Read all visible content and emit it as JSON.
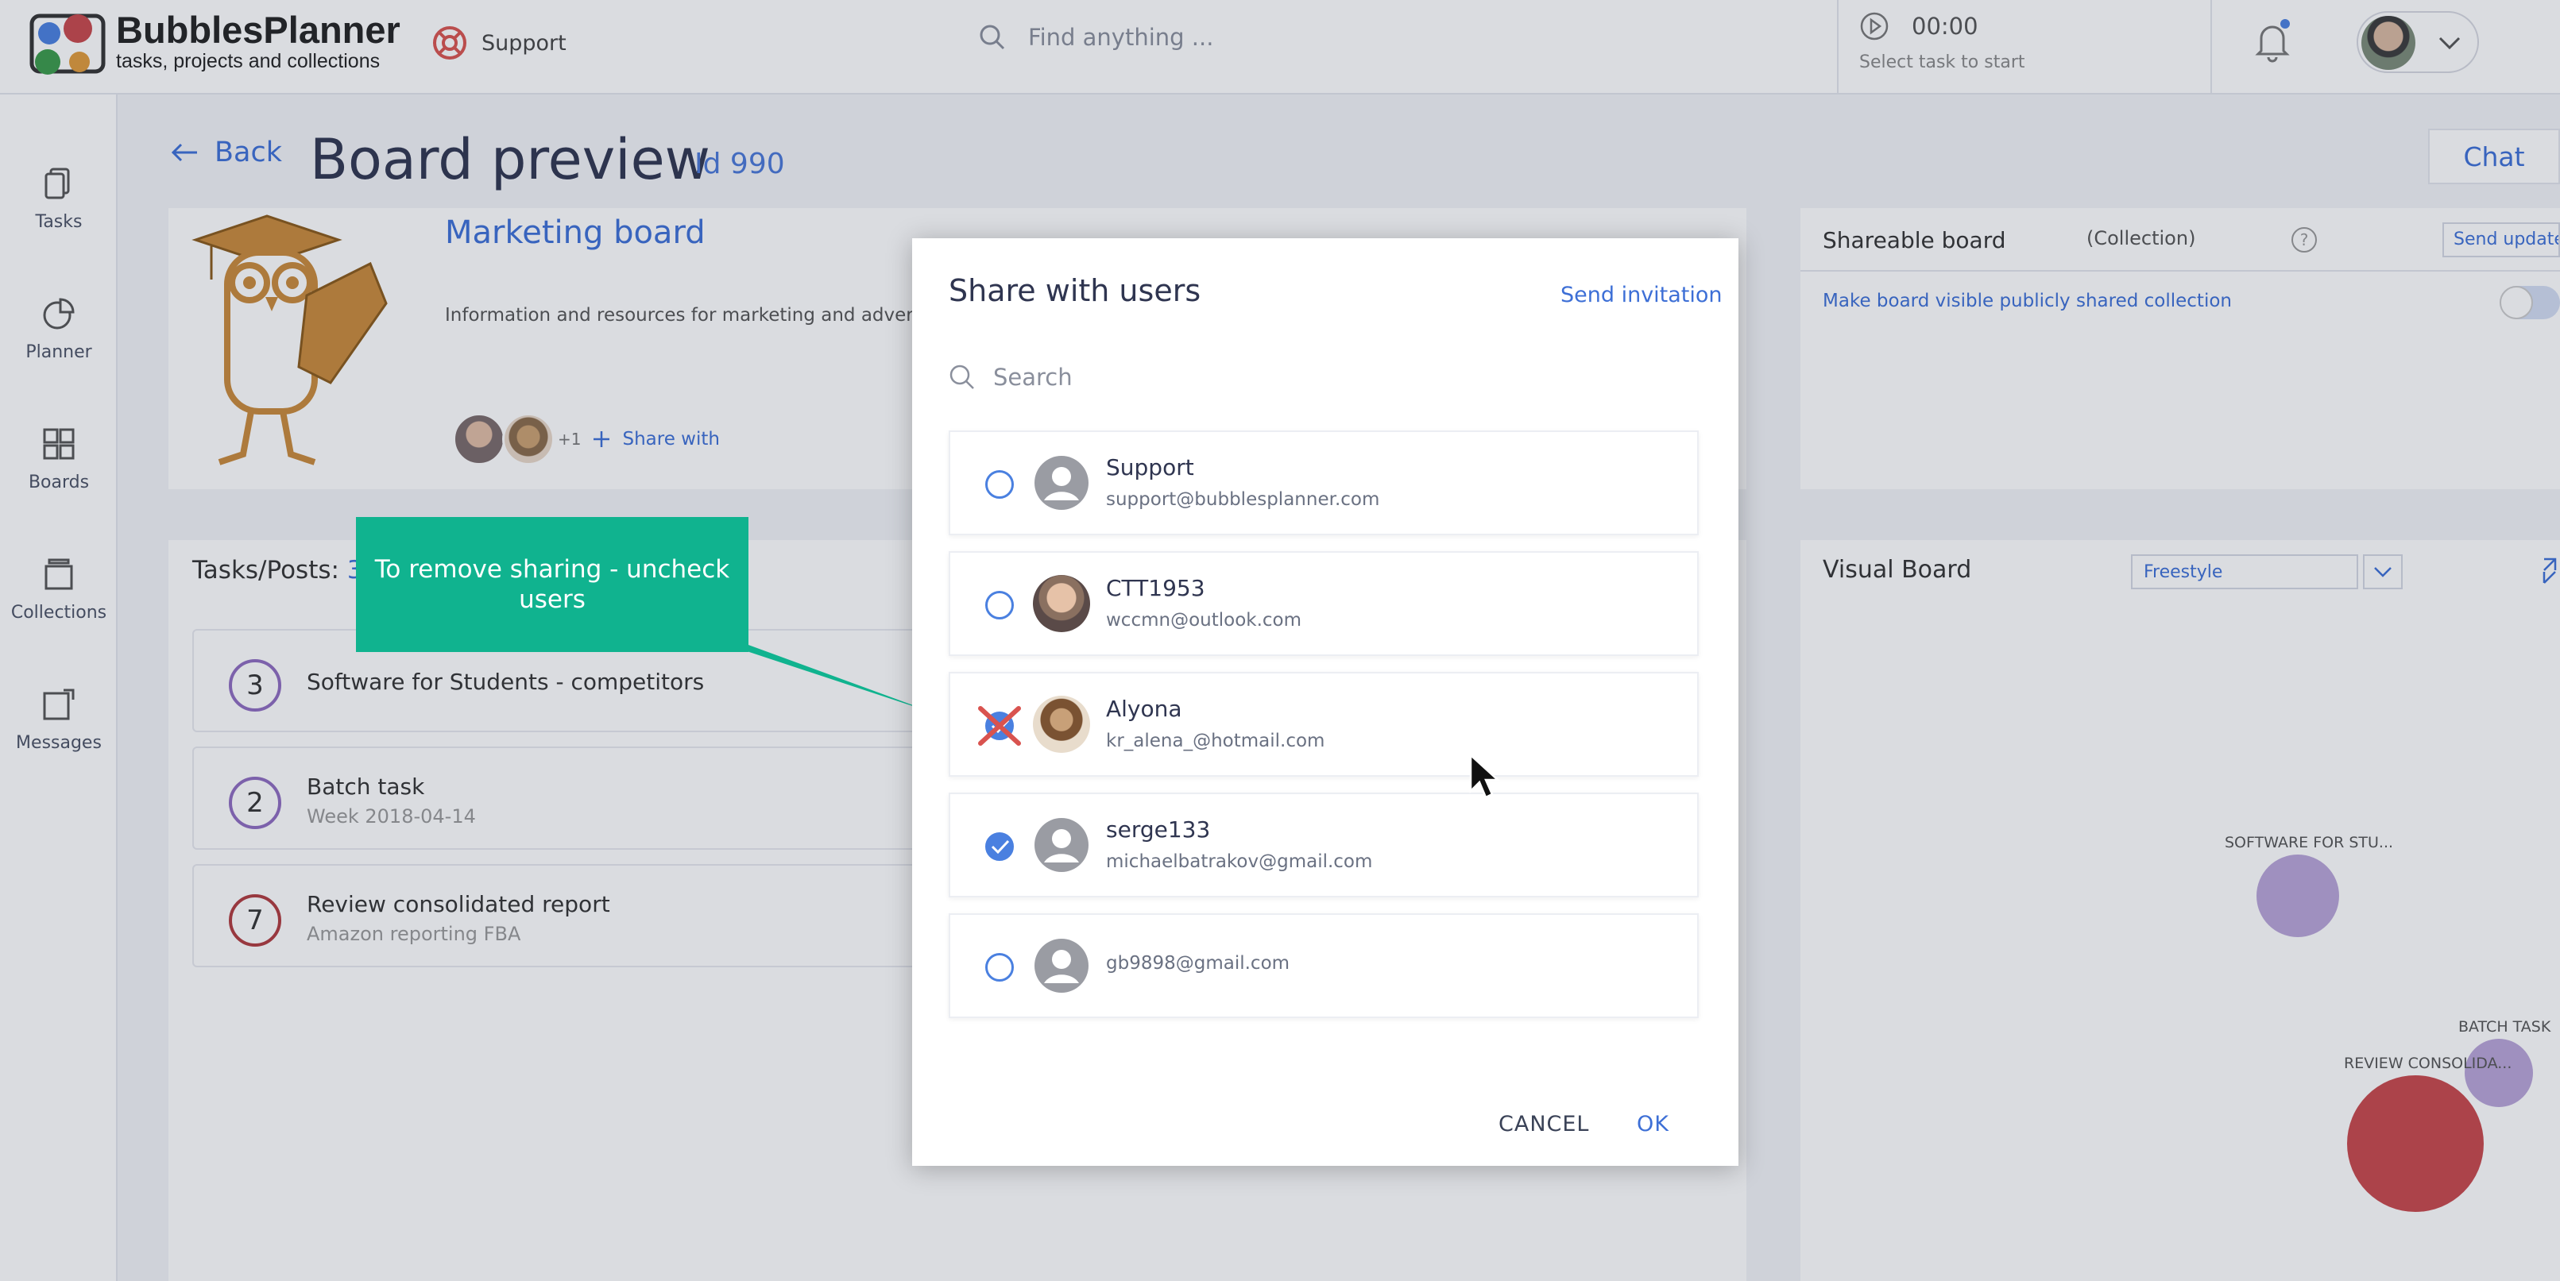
{
  "app": {
    "name": "BubblesPlanner",
    "tagline": "tasks, projects and collections"
  },
  "topbar": {
    "support_label": "Support",
    "search_placeholder": "Find anything ...",
    "timer_time": "00:00",
    "timer_hint": "Select task to start"
  },
  "sidebar": {
    "items": [
      {
        "label": "Tasks",
        "icon": "tasks-icon"
      },
      {
        "label": "Planner",
        "icon": "planner-icon"
      },
      {
        "label": "Boards",
        "icon": "boards-icon"
      },
      {
        "label": "Collections",
        "icon": "collections-icon"
      },
      {
        "label": "Messages",
        "icon": "messages-icon"
      }
    ]
  },
  "page": {
    "back_label": "Back",
    "title": "Board preview",
    "id_label": "Id 990",
    "chat_label": "Chat"
  },
  "board": {
    "name": "Marketing board",
    "description": "Information and resources for marketing and advertising",
    "extra_members": "+1",
    "share_with_label": "Share with"
  },
  "tasks": {
    "title": "Tasks/Posts:",
    "count": "3",
    "items": [
      {
        "number": "3",
        "name": "Software for Students - competitors",
        "sub": ""
      },
      {
        "number": "2",
        "name": "Batch task",
        "sub": "Week 2018-04-14"
      },
      {
        "number": "7",
        "name": "Review consolidated report",
        "sub": "Amazon reporting FBA"
      }
    ]
  },
  "shareable": {
    "title": "Shareable board",
    "collection_label": "(Collection)",
    "help": "?",
    "send_update_label": "Send update",
    "make_public_label": "Make board visible publicly shared collection"
  },
  "visual_board": {
    "title": "Visual Board",
    "mode": "Freestyle",
    "bubbles": [
      {
        "label": "SOFTWARE FOR STU...",
        "color": "#b9a4d8"
      },
      {
        "label": "BATCH TASK",
        "color": "#b9a4d8"
      },
      {
        "label": "REVIEW CONSOLIDA...",
        "color": "#c8474b"
      }
    ]
  },
  "callout": {
    "text": "To remove sharing - uncheck users",
    "color": "#10b38f"
  },
  "modal": {
    "title": "Share with users",
    "send_invitation_label": "Send invitation",
    "search_placeholder": "Search",
    "users": [
      {
        "name": "Support",
        "email": "support@bubblesplanner.com",
        "checked": false
      },
      {
        "name": "CTT1953",
        "email": "wccmn@outlook.com",
        "checked": false
      },
      {
        "name": "Alyona",
        "email": "kr_alena_@hotmail.com",
        "checked": true
      },
      {
        "name": "serge133",
        "email": "michaelbatrakov@gmail.com",
        "checked": true
      },
      {
        "name": "",
        "email": "gb9898@gmail.com",
        "checked": false
      }
    ],
    "cancel_label": "CANCEL",
    "ok_label": "OK"
  },
  "colors": {
    "accent": "#3d6fd6",
    "text": "#2f3550",
    "callout": "#10b38f",
    "remove_mark": "#d9534f"
  }
}
